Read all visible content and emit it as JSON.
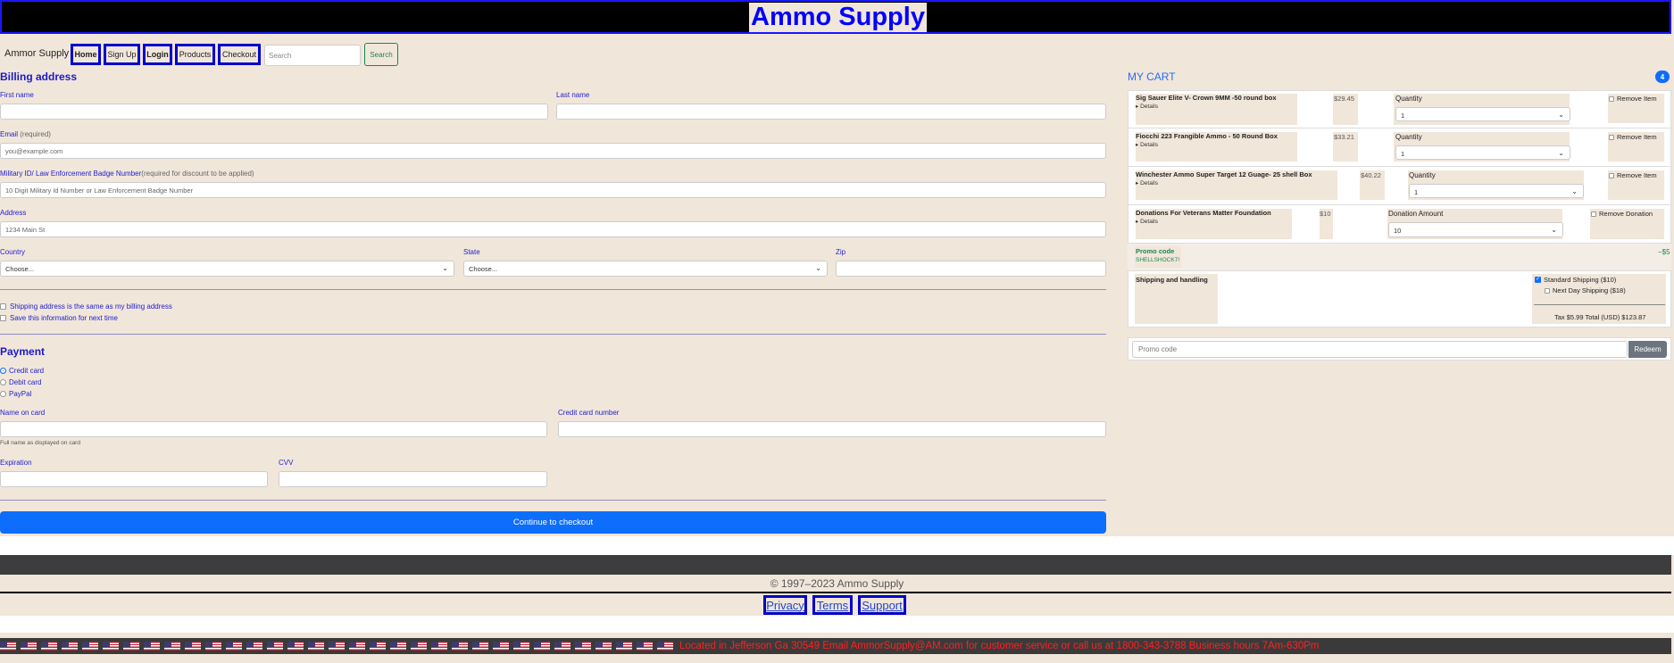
{
  "header": {
    "title": "Ammo Supply"
  },
  "nav": {
    "brand": "Ammor Supply",
    "links": [
      "Home",
      "Sign Up",
      "Login",
      "Products",
      "Checkout"
    ],
    "search_placeholder": "Search",
    "search_label": "Search"
  },
  "billing": {
    "heading": "Billing address",
    "first_name_label": "First name",
    "last_name_label": "Last name",
    "email_label": "Email",
    "email_required": "(required)",
    "email_placeholder": "you@example.com",
    "military_label": "Military ID/ Law Enforcement Badge Number",
    "military_note": "(required for discount to be applied)",
    "military_placeholder": "10 Digit Military Id Number or Law Enforcement Badge Number",
    "address_label": "Address",
    "address_placeholder": "1234 Main St",
    "country_label": "Country",
    "country_value": "Choose...",
    "state_label": "State",
    "state_value": "Choose...",
    "zip_label": "Zip",
    "same_address": "Shipping address is the same as my billing address",
    "save_info": "Save this information for next time"
  },
  "payment": {
    "heading": "Payment",
    "methods": [
      "Credit card",
      "Debit card",
      "PayPal"
    ],
    "name_label": "Name on card",
    "name_help": "Full name as displayed on card",
    "number_label": "Credit card number",
    "expiration_label": "Expiration",
    "cvv_label": "CVV",
    "continue_label": "Continue to checkout"
  },
  "cart": {
    "title": "MY CART",
    "count": "4",
    "details_label": "Details",
    "quantity_label": "Quantity",
    "remove_label": "Remove Item",
    "items": [
      {
        "name": "Sig Sauer Elite V- Crown 9MM -50 round box",
        "price": "$29.45",
        "qty": "1"
      },
      {
        "name": "Fiocchi 223 Frangible Ammo - 50 Round Box",
        "price": "$33.21",
        "qty": "1"
      },
      {
        "name": "Winchester Ammo Super Target 12 Guage- 25 shell Box",
        "price": "$40.22",
        "qty": "1"
      }
    ],
    "donation": {
      "name": "Donations For Veterans Matter Foundation",
      "price": "$10",
      "amount_label": "Donation Amount",
      "amount": "10",
      "remove_label": "Remove Donation"
    },
    "promo": {
      "label": "Promo code",
      "code": "SHELLSHOCK7!",
      "value": "−$5"
    },
    "shipping": {
      "label": "Shipping and handling",
      "standard": "Standard Shipping ($10)",
      "next_day": "Next Day Shipping ($18)",
      "totals": "Tax $5.99 Total (USD) $123.87"
    },
    "promo_form": {
      "placeholder": "Promo code",
      "button": "Redeem"
    }
  },
  "footer": {
    "copyright": "© 1997–2023 Ammo Supply",
    "links": [
      "Privacy",
      "Terms",
      "Support"
    ],
    "ticker": "Located in Jefferson Ga 30549 Email AmmorSupply@AM.com for customer service or call us at 1800-343-3788 Business hours 7Am-630Pm"
  },
  "colors": {
    "accent": "#0d6efd",
    "background": "#f1e6da",
    "link_border": "#0000cc",
    "ticker_text": "#ff2020"
  },
  "icons": [
    "chevron-down-icon",
    "us-flag-icon"
  ]
}
